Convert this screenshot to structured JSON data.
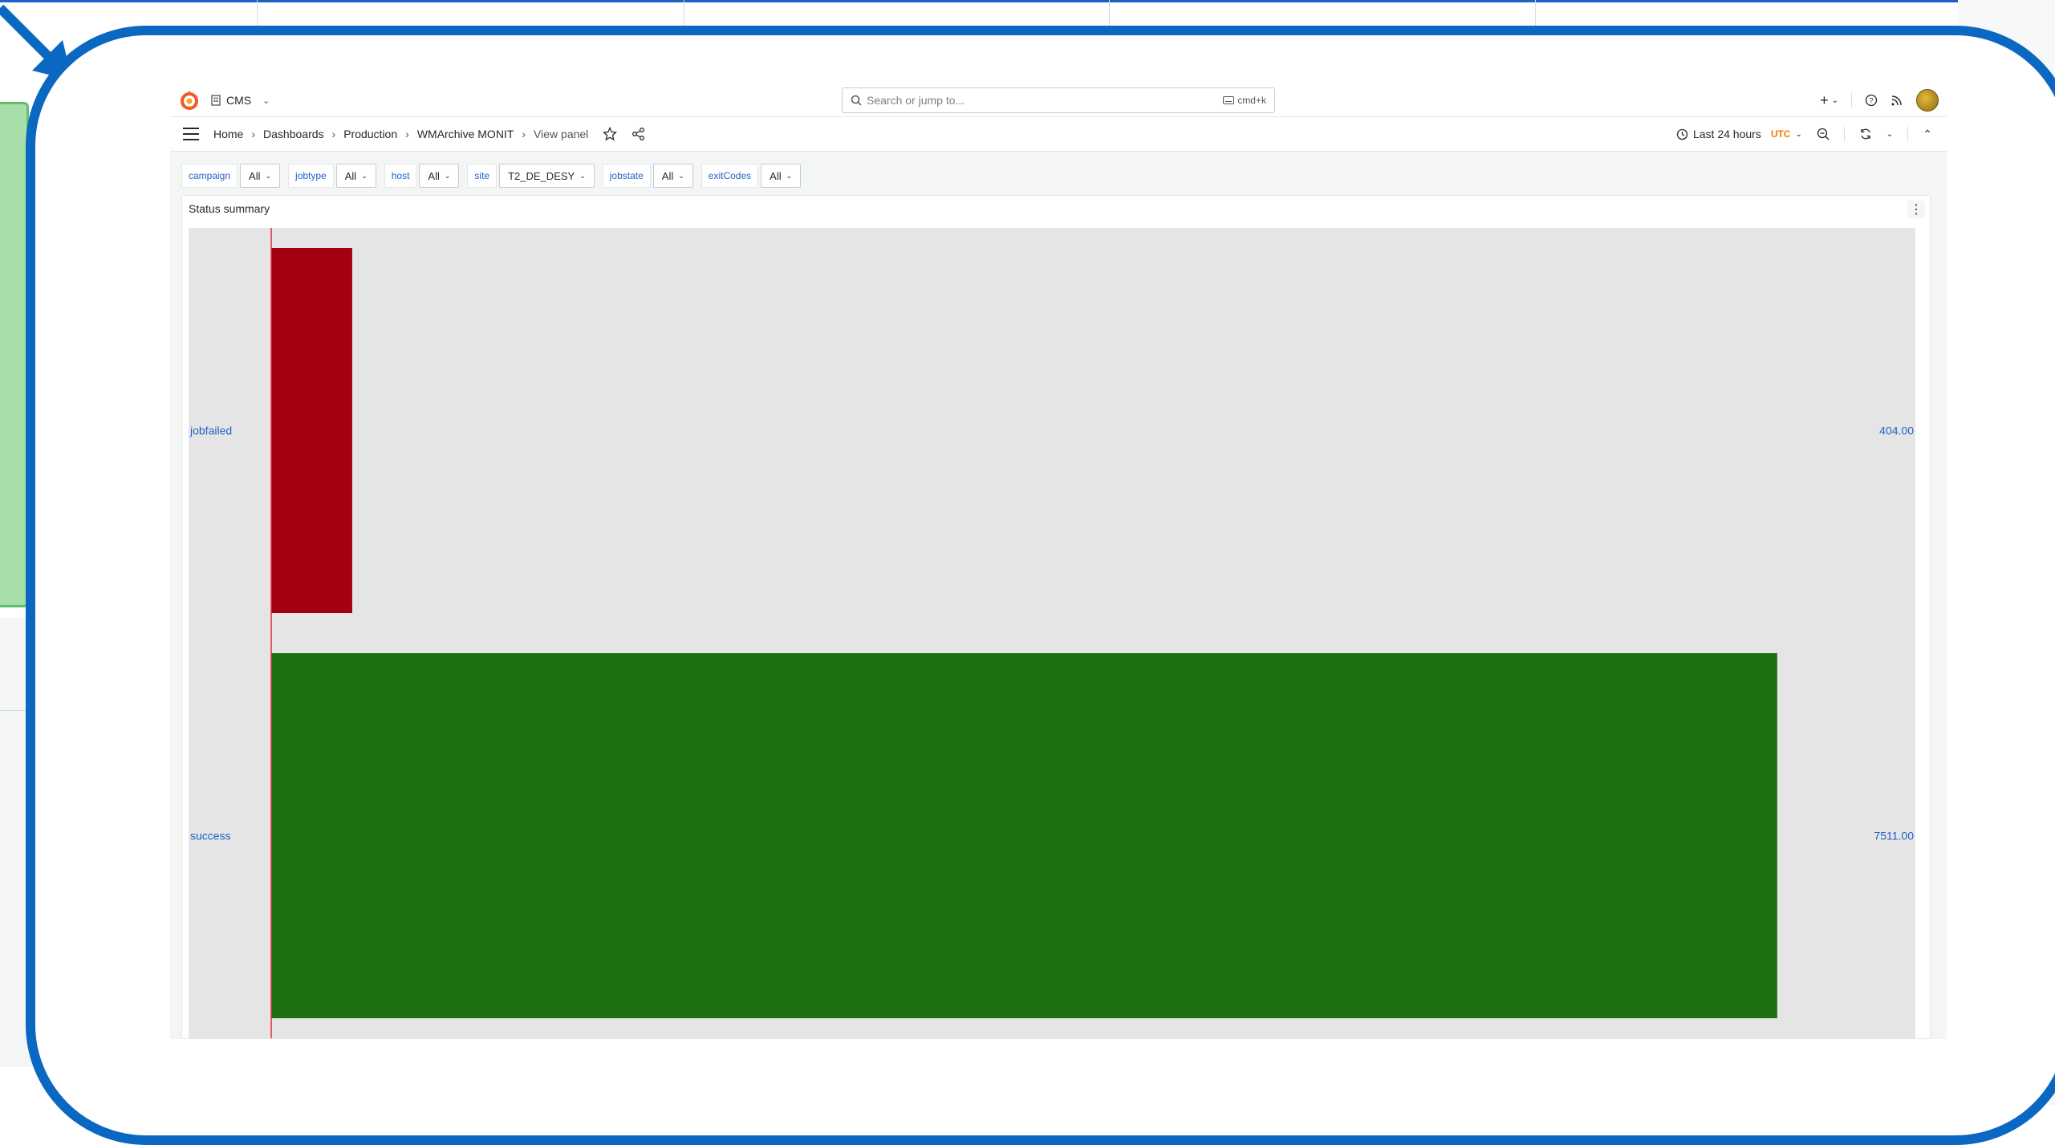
{
  "topbar": {
    "org_name": "CMS",
    "search_placeholder": "Search or jump to...",
    "search_shortcut": "cmd+k",
    "add_label": "+"
  },
  "breadcrumbs": [
    "Home",
    "Dashboards",
    "Production",
    "WMArchive MONIT",
    "View panel"
  ],
  "timepicker": {
    "range": "Last 24 hours",
    "timezone": "UTC"
  },
  "variables": [
    {
      "label": "campaign",
      "value": "All"
    },
    {
      "label": "jobtype",
      "value": "All"
    },
    {
      "label": "host",
      "value": "All"
    },
    {
      "label": "site",
      "value": "T2_DE_DESY"
    },
    {
      "label": "jobstate",
      "value": "All"
    },
    {
      "label": "exitCodes",
      "value": "All"
    }
  ],
  "panel": {
    "title": "Status summary"
  },
  "colors": {
    "failed": "#a50012",
    "success": "#1e7113",
    "track": "#e5e5e5",
    "threshold": "#e02f44",
    "link": "#1f62c7",
    "highlight": "#0b68c2"
  },
  "chart_data": {
    "type": "bar",
    "orientation": "horizontal",
    "categories": [
      "jobfailed",
      "success"
    ],
    "values": [
      404,
      7511
    ],
    "value_labels": [
      "404.00",
      "7511.00"
    ],
    "xlim": [
      0,
      8200
    ]
  }
}
